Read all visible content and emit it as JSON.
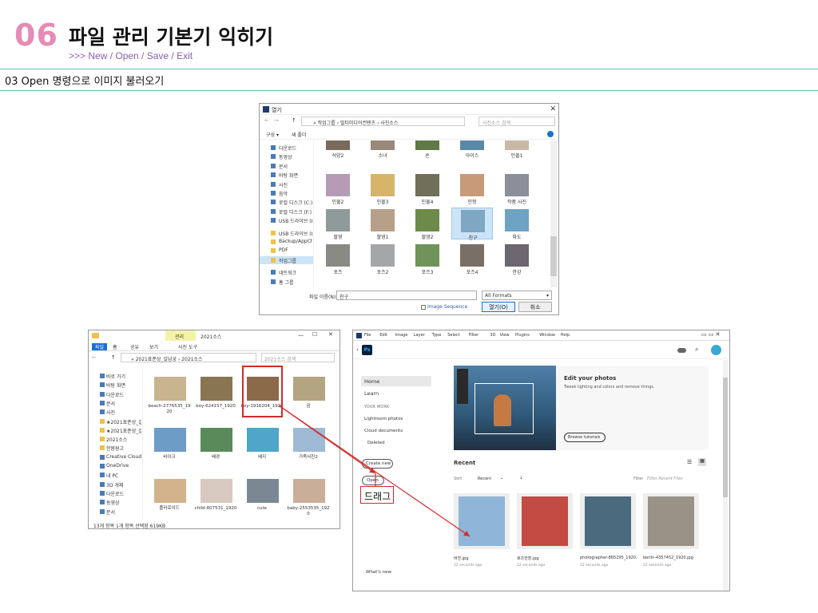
{
  "header": {
    "number": "06",
    "title": "파일 관리 기본기 익히기",
    "subtitle": ">>> New / Open / Save / Exit"
  },
  "section": {
    "title": "03 Open 명령으로 이미지 불러오기"
  },
  "open_dialog": {
    "title": "열기",
    "path": "« 작업그룹 › 멀티미디어컨텐츠 › 사진소스",
    "search_placeholder": "사진소스 검색",
    "organize": "구성 ▾",
    "new_folder": "새 폴더",
    "nav_items": [
      "다운로드",
      "동영상",
      "문서",
      "바탕 화면",
      "사진",
      "음악",
      "로컬 디스크 (C:)",
      "로컬 디스크 (F:)",
      "USB 드라이브 (L:)",
      "USB 드라이브 (L:)",
      "Backup/AppChe",
      "PDF",
      "작업그룹",
      "네트워크",
      "홈 그룹"
    ],
    "thumbs": [
      {
        "label": "석양2",
        "color": "#7a6a5a"
      },
      {
        "label": "소녀",
        "color": "#9a8878"
      },
      {
        "label": "손",
        "color": "#5f7a45"
      },
      {
        "label": "아이스",
        "color": "#5a88a8"
      },
      {
        "label": "인물1",
        "color": "#c9b8a6"
      },
      {
        "label": "인물2",
        "color": "#b59bb6"
      },
      {
        "label": "인물3",
        "color": "#d6b56a"
      },
      {
        "label": "인물4",
        "color": "#6f6f5a"
      },
      {
        "label": "인형",
        "color": "#c99a7a"
      },
      {
        "label": "작품 사진",
        "color": "#8a8f99"
      },
      {
        "label": "할영",
        "color": "#8f9a9a"
      },
      {
        "label": "할영1",
        "color": "#b7a088"
      },
      {
        "label": "할영2",
        "color": "#6d8a4a"
      },
      {
        "label": "친구",
        "color": "#7fa6c3"
      },
      {
        "label": "파도",
        "color": "#6fa3c4"
      },
      {
        "label": "포즈",
        "color": "#8a8a84"
      },
      {
        "label": "포즈2",
        "color": "#a5a6a8"
      },
      {
        "label": "포즈3",
        "color": "#70935a"
      },
      {
        "label": "포즈4",
        "color": "#7a6f66"
      },
      {
        "label": "한강",
        "color": "#6b6670"
      }
    ],
    "filename_label": "파일 이름(N):",
    "filename_value": "친구",
    "format": "All Formats",
    "image_sequence": "Image Sequence",
    "open_button": "열기(O)",
    "cancel_button": "취소"
  },
  "explorer": {
    "ribbon_tab_highlight": "관리",
    "folder_title": "2021소스",
    "tabs": [
      "파일",
      "홈",
      "공유",
      "보기",
      "사진 도구"
    ],
    "path": "« 2021표준상_길남궁 › 2021소스",
    "search_placeholder": "2021소스 검색",
    "nav_items": [
      "바로 가기",
      "바탕 화면",
      "다운로드",
      "문서",
      "사진",
      "★2021표준상_길",
      "★2021표준상_걸",
      "2021소스",
      "한봄원고",
      "Creative Cloud Fil",
      "OneDrive",
      "내 PC",
      "3D 개체",
      "다운로드",
      "동영상",
      "문서"
    ],
    "files": [
      {
        "label": "beach-2776535_1920",
        "color": "#c8b48e"
      },
      {
        "label": "boy-624157_1920",
        "color": "#8a7552"
      },
      {
        "label": "boy-1916204_1920",
        "color": "#8a6a48"
      },
      {
        "label": "곰",
        "color": "#b4a582"
      },
      {
        "label": "바이크",
        "color": "#6d9cc6"
      },
      {
        "label": "배경",
        "color": "#5b8a5a"
      },
      {
        "label": "배지",
        "color": "#4fa6c8"
      },
      {
        "label": "가족사진2",
        "color": "#9fbad4"
      },
      {
        "label": "플라로이드",
        "color": "#d2b38c"
      },
      {
        "label": "child-807531_1920",
        "color": "#d8c9c0"
      },
      {
        "label": "cute",
        "color": "#7b8894"
      },
      {
        "label": "baby-2553535_1920",
        "color": "#c9ae9a"
      }
    ],
    "status": "13개 항목     1개 항목 선택함 619KB"
  },
  "photoshop": {
    "menu": [
      "File",
      "Edit",
      "Image",
      "Layer",
      "Type",
      "Select",
      "Filter",
      "3D",
      "View",
      "Plugins",
      "Window",
      "Help"
    ],
    "sidebar": [
      "Home",
      "Learn"
    ],
    "your_work_label": "YOUR WORK",
    "work_items": [
      "Lightroom photos",
      "Cloud documents",
      "Deleted"
    ],
    "create_new": "Create new",
    "open": "Open",
    "whats_new": "What's new",
    "hero_title": "Edit your photos",
    "hero_text": "Tweak lighting and colors and remove things.",
    "hero_button": "Browse tutorials",
    "recent_label": "Recent",
    "sort_label": "Sort",
    "sort_value": "Recent",
    "filter_label": "Filter",
    "filter_placeholder": "Filter Recent Files",
    "recent_files": [
      {
        "name": "버전.jpg",
        "time": "22 seconds ago",
        "color": "#8fb6d8"
      },
      {
        "name": "로즈한장.jpg",
        "time": "22 seconds ago",
        "color": "#c44a44"
      },
      {
        "name": "photographer-865295_1920...",
        "time": "22 seconds ago",
        "color": "#4a6a7e"
      },
      {
        "name": "berlin-4357452_1920.jpg",
        "time": "22 seconds ago",
        "color": "#9a9287"
      }
    ]
  },
  "annotation": {
    "drag_label": "드래그"
  },
  "colors": {
    "accent_pink": "#e58bb5",
    "accent_teal": "#5bc0b8",
    "subtitle_purple": "#8a5fb0",
    "highlight_red": "#d42a2a"
  }
}
